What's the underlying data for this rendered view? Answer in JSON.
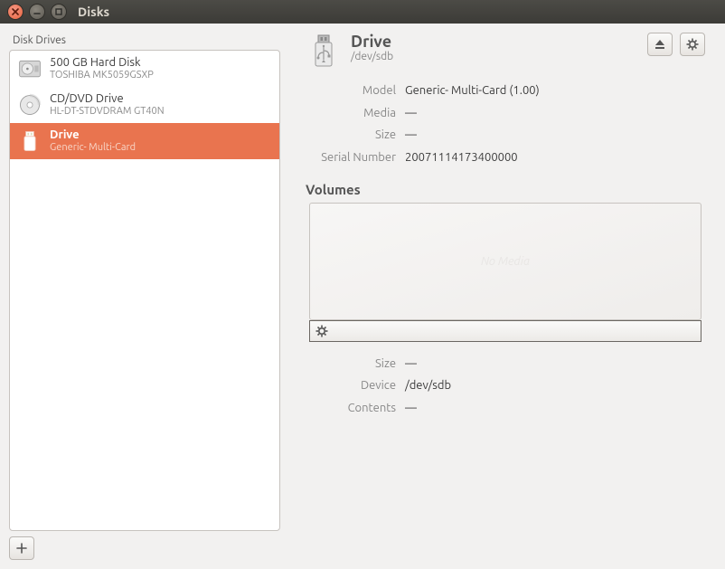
{
  "window": {
    "title": "Disks"
  },
  "sidebar": {
    "label": "Disk Drives",
    "items": [
      {
        "title": "500 GB Hard Disk",
        "subtitle": "TOSHIBA MK5059GSXP",
        "icon": "hdd",
        "selected": false
      },
      {
        "title": "CD/DVD Drive",
        "subtitle": "HL-DT-STDVDRAM GT40N",
        "icon": "optical",
        "selected": false
      },
      {
        "title": "Drive",
        "subtitle": "Generic- Multi-Card",
        "icon": "usb",
        "selected": true
      }
    ],
    "add_tooltip": "Add"
  },
  "drive": {
    "title": "Drive",
    "device_path": "/dev/sdb",
    "props": {
      "model_label": "Model",
      "model_value": "Generic- Multi-Card (1.00)",
      "media_label": "Media",
      "media_value": "—",
      "size_label": "Size",
      "size_value": "—",
      "serial_label": "Serial Number",
      "serial_value": "20071114173400000"
    },
    "actions": {
      "eject_tooltip": "Eject",
      "options_tooltip": "Drive options"
    }
  },
  "volumes": {
    "section_title": "Volumes",
    "no_media": "No Media",
    "gear_tooltip": "Volume options",
    "props": {
      "size_label": "Size",
      "size_value": "—",
      "device_label": "Device",
      "device_value": "/dev/sdb",
      "contents_label": "Contents",
      "contents_value": "—"
    }
  }
}
